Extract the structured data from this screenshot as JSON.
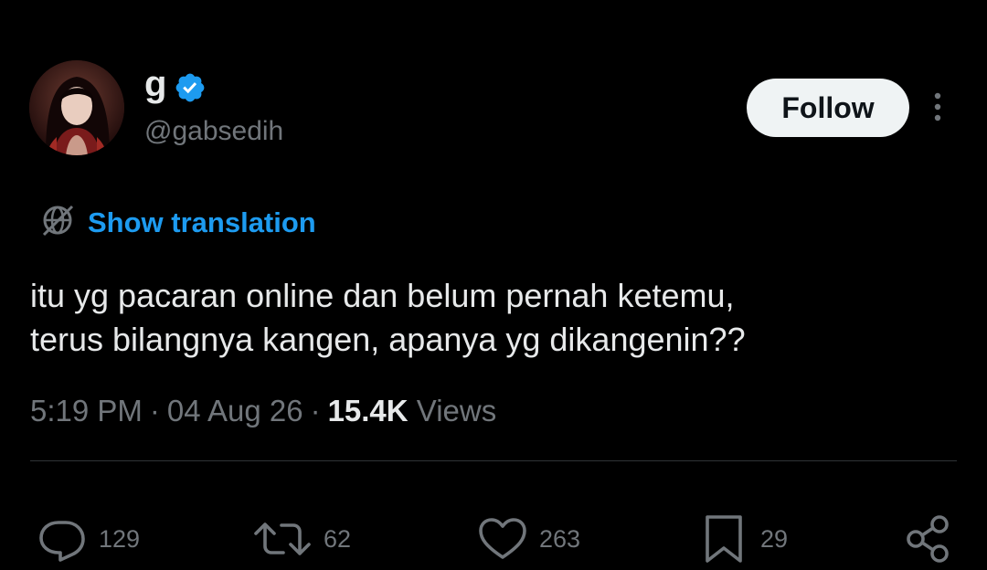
{
  "author": {
    "display_name": "g",
    "handle": "@gabsedih",
    "verified": true
  },
  "follow_label": "Follow",
  "translation_label": "Show translation",
  "tweet": {
    "lines": [
      "itu yg pacaran online dan belum pernah ketemu,",
      "terus bilangnya kangen, apanya yg dikangenin??"
    ]
  },
  "meta": {
    "time": "5:19 PM",
    "separator": "·",
    "date": "04 Aug 26",
    "views_count": "15.4K",
    "views_label": "Views"
  },
  "actions": {
    "replies": "129",
    "reposts": "62",
    "likes": "263",
    "bookmarks": "29"
  },
  "colors": {
    "background": "#000000",
    "text": "#e7e9ea",
    "secondary": "#71767b",
    "link": "#1d9bf0",
    "verified": "#1d9bf0",
    "follow_bg": "#eff3f4"
  },
  "icons": [
    "avatar",
    "verified-badge-icon",
    "more-icon",
    "translate-icon",
    "reply-icon",
    "repost-icon",
    "like-icon",
    "bookmark-icon",
    "share-icon"
  ]
}
